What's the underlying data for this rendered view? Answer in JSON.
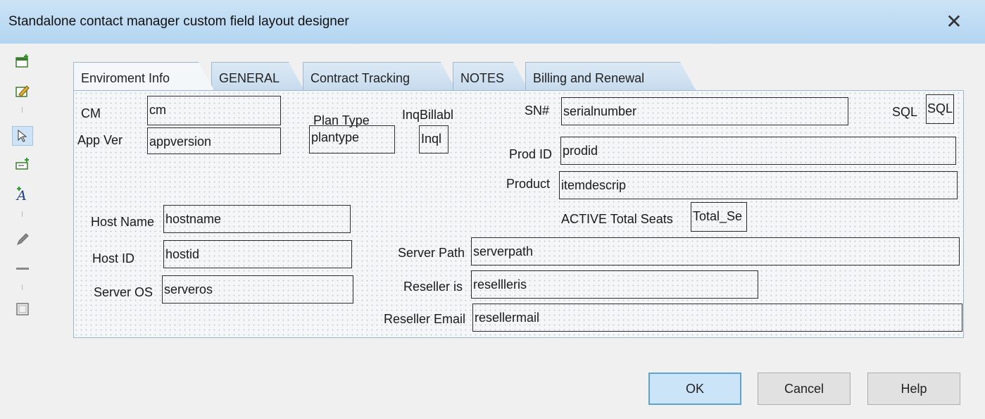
{
  "window": {
    "title": "Standalone contact manager custom field layout designer",
    "close_glyph": "✕"
  },
  "toolbar": {
    "tools": [
      {
        "icon": "add-record-icon"
      },
      {
        "icon": "edit-record-icon"
      },
      {
        "icon": "pointer-select-icon"
      },
      {
        "icon": "add-field-icon"
      },
      {
        "icon": "add-text-icon"
      },
      {
        "icon": "pencil-icon"
      },
      {
        "icon": "line-icon"
      },
      {
        "icon": "box-icon"
      }
    ]
  },
  "tabs": [
    {
      "label": "Enviroment Info",
      "active": true
    },
    {
      "label": "GENERAL",
      "active": false
    },
    {
      "label": "Contract Tracking",
      "active": false
    },
    {
      "label": "NOTES",
      "active": false
    },
    {
      "label": "Billing and Renewal",
      "active": false
    }
  ],
  "form": {
    "labels": {
      "cm": "CM",
      "app_ver": "App Ver",
      "plan_type": "Plan Type",
      "inq_billable": "InqBillabl",
      "sn": "SN#",
      "sql": "SQL",
      "prod_id": "Prod ID",
      "product": "Product",
      "host_name": "Host Name",
      "active_total_seats": "ACTIVE Total Seats",
      "host_id": "Host ID",
      "server_path": "Server Path",
      "server_os": "Server OS",
      "reseller_is": "Reseller is",
      "reseller_email": "Reseller Email"
    },
    "fields": {
      "cm": "cm",
      "appversion": "appversion",
      "plantype": "plantype",
      "inq": "Inql",
      "serialnumber": "serialnumber",
      "sql": "SQL",
      "prodid": "prodid",
      "itemdescrip": "itemdescrip",
      "hostname": "hostname",
      "total_seats": "Total_Se",
      "hostid": "hostid",
      "serverpath": "serverpath",
      "serveros": "serveros",
      "resellleris": "resellleris",
      "resellermail": "resellermail"
    }
  },
  "buttons": {
    "ok": "OK",
    "cancel": "Cancel",
    "help": "Help"
  }
}
